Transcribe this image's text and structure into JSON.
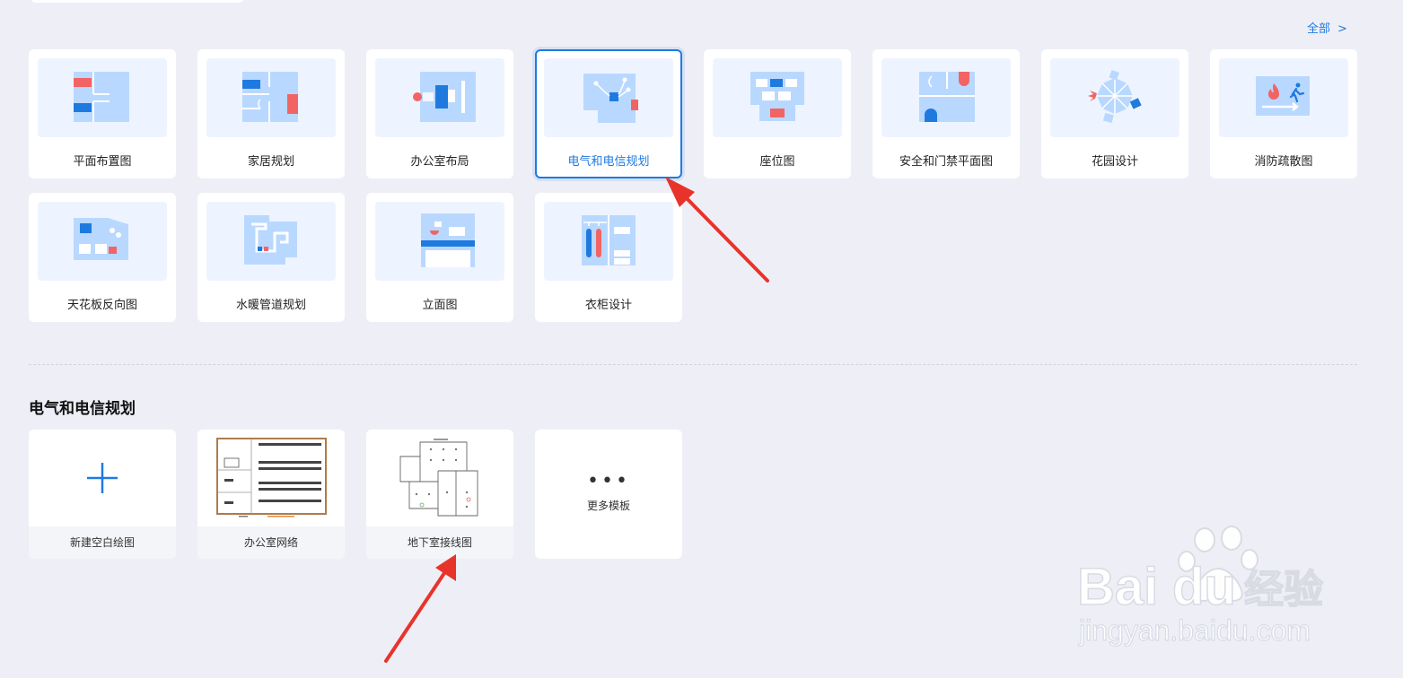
{
  "header": {
    "view_all_label": "全部",
    "view_all_chevron": ">"
  },
  "categories": [
    {
      "label": "平面布置图",
      "icon": "floor-plan-icon"
    },
    {
      "label": "家居规划",
      "icon": "home-plan-icon"
    },
    {
      "label": "办公室布局",
      "icon": "office-layout-icon"
    },
    {
      "label": "电气和电信规划",
      "icon": "electrical-plan-icon",
      "selected": true
    },
    {
      "label": "座位图",
      "icon": "seating-chart-icon"
    },
    {
      "label": "安全和门禁平面图",
      "icon": "security-plan-icon"
    },
    {
      "label": "花园设计",
      "icon": "garden-design-icon"
    },
    {
      "label": "消防疏散图",
      "icon": "fire-evacuation-icon"
    },
    {
      "label": "天花板反向图",
      "icon": "ceiling-plan-icon"
    },
    {
      "label": "水暖管道规划",
      "icon": "plumbing-plan-icon"
    },
    {
      "label": "立面图",
      "icon": "elevation-icon"
    },
    {
      "label": "衣柜设计",
      "icon": "wardrobe-icon"
    }
  ],
  "section": {
    "title": "电气和电信规划"
  },
  "templates": [
    {
      "label": "新建空白绘图",
      "icon": "plus-icon"
    },
    {
      "label": "办公室网络",
      "icon": "office-network-thumbnail"
    },
    {
      "label": "地下室接线图",
      "icon": "basement-wiring-thumbnail"
    },
    {
      "label": "更多模板",
      "icon": "more-dots-icon",
      "dots": "•••"
    }
  ],
  "watermark": {
    "brand": "Bai",
    "brand_suffix": "du",
    "jingyan": "经验",
    "url": "jingyan.baidu.com"
  },
  "colors": {
    "accent": "#1f7ae0",
    "icon_blue": "#1f7ae0",
    "icon_light": "#b9d8ff",
    "icon_red": "#f26464",
    "background": "#eeeff6"
  }
}
